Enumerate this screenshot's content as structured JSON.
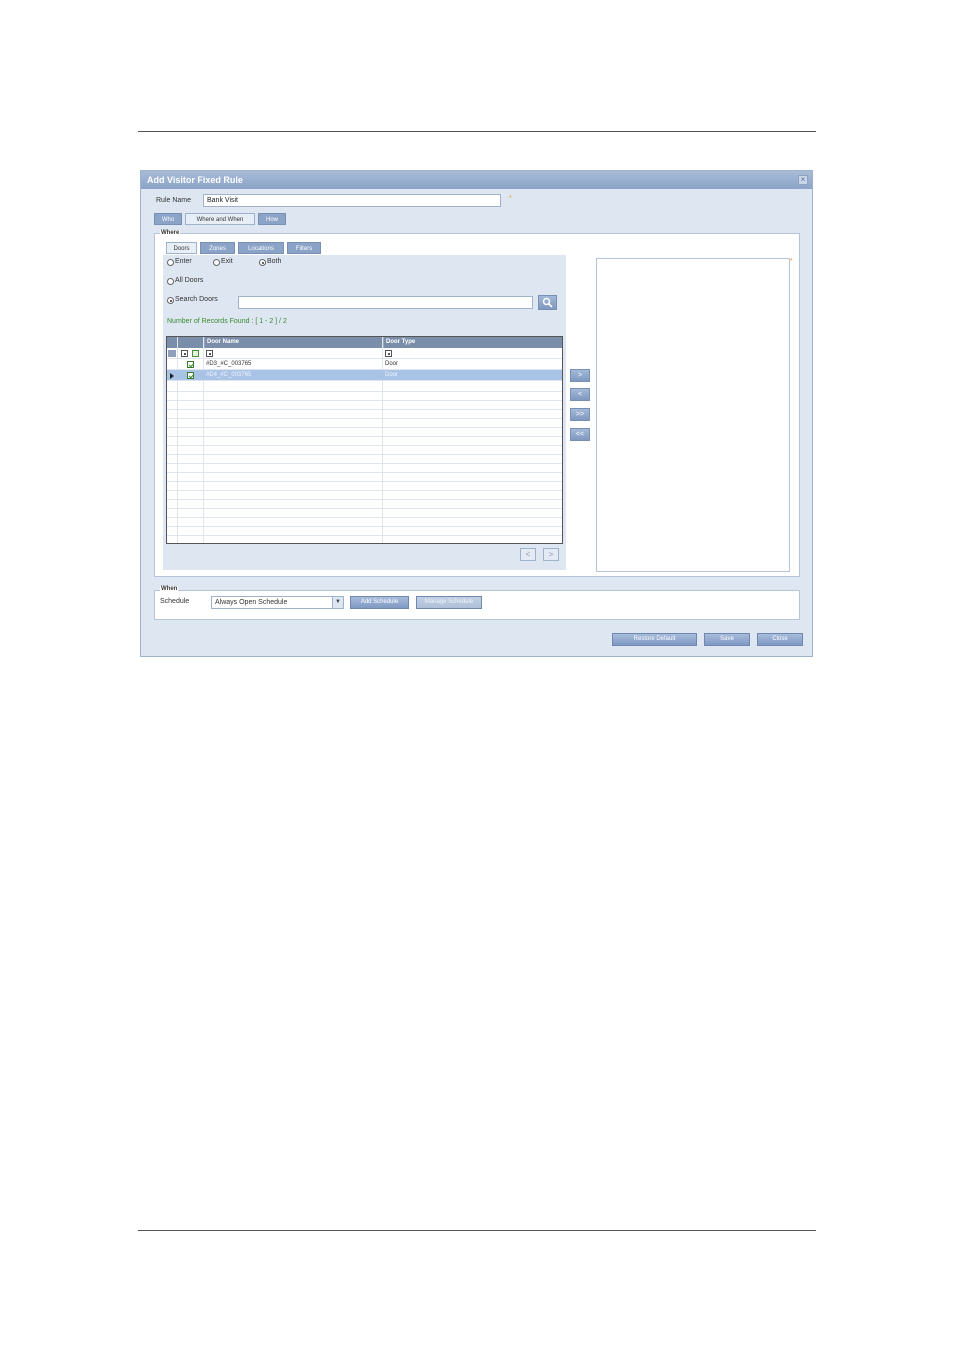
{
  "dialog": {
    "title": "Add Visitor Fixed Rule",
    "close_glyph": "×",
    "rule_name_label": "Rule Name",
    "rule_name_value": "Bank Visit",
    "required_marker": "*",
    "tabs": [
      "Who",
      "Where and When",
      "How"
    ],
    "active_tab": "Where and When"
  },
  "where": {
    "legend": "Where",
    "subtabs": [
      "Doors",
      "Zones",
      "Locations",
      "Filters"
    ],
    "active_subtab": "Doors",
    "direction": {
      "enter": "Enter",
      "exit": "Exit",
      "both": "Both",
      "selected": "Both"
    },
    "all_doors_label": "All Doors",
    "search_doors_label": "Search Doors",
    "search_value": "",
    "records_found": "Number of Records Found : [ 1 - 2 ] / 2",
    "grid": {
      "columns": [
        "Door Name",
        "Door Type"
      ],
      "rows": [
        {
          "name": "#D3_#C_003765",
          "type": "Door",
          "checked": true,
          "selected": false
        },
        {
          "name": "#D4_#C_003765",
          "type": "Door",
          "checked": true,
          "selected": true
        }
      ]
    },
    "prev_page": "<",
    "next_page": ">",
    "move_buttons": [
      ">",
      "<",
      ">>",
      "<<"
    ],
    "selected_marker": "*"
  },
  "when": {
    "legend": "When",
    "schedule_label": "Schedule",
    "schedule_value": "Always Open Schedule",
    "add_schedule": "Add Schedule",
    "manage_schedule": "Manage Schedule"
  },
  "footer": {
    "restore_default": "Restore Default",
    "save": "Save",
    "close": "Close"
  },
  "colors": {
    "titlebar": "#8aa3c7",
    "dialog_bg": "#dde6f1",
    "grid_header": "#7a8da9",
    "selected_row": "#a9c3e6",
    "records_text": "#3b8a2f"
  }
}
